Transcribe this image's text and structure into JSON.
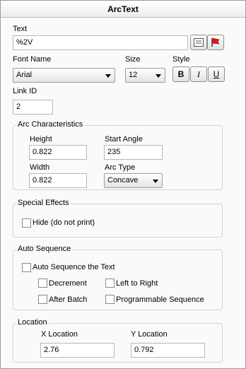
{
  "title": "ArcText",
  "text_section": {
    "label": "Text",
    "value": "%2V",
    "edit_icon": "edit-icon",
    "flag_icon": "flag-icon"
  },
  "font": {
    "name_label": "Font Name",
    "name_value": "Arial",
    "size_label": "Size",
    "size_value": "12",
    "style_label": "Style",
    "bold": "B",
    "italic": "I",
    "underline": "U"
  },
  "link": {
    "label": "Link ID",
    "value": "2"
  },
  "arc": {
    "title": "Arc Characteristics",
    "height_label": "Height",
    "height_value": "0.822",
    "start_angle_label": "Start Angle",
    "start_angle_value": "235",
    "width_label": "Width",
    "width_value": "0.822",
    "arc_type_label": "Arc Type",
    "arc_type_value": "Concave"
  },
  "effects": {
    "title": "Special Effects",
    "hide_label": "Hide (do not print)"
  },
  "auto_seq": {
    "title": "Auto Sequence",
    "auto_label": "Auto Sequence the Text",
    "decrement_label": "Decrement",
    "left_to_right_label": "Left to Right",
    "after_batch_label": "After Batch",
    "programmable_label": "Programmable Sequence"
  },
  "location": {
    "title": "Location",
    "x_label": "X Location",
    "x_value": "2.76",
    "y_label": "Y Location",
    "y_value": "0.792"
  }
}
